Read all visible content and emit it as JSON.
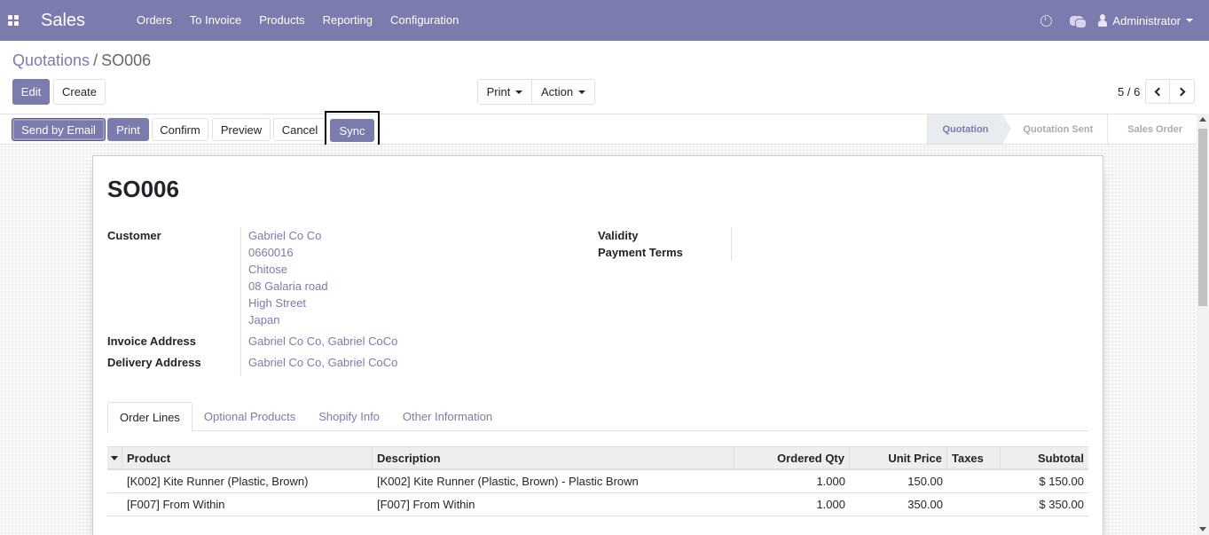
{
  "navbar": {
    "app_name": "Sales",
    "menu": [
      "Orders",
      "To Invoice",
      "Products",
      "Reporting",
      "Configuration"
    ],
    "user": "Administrator",
    "bg_color": "#7c7bad"
  },
  "breadcrumb": {
    "parent": "Quotations",
    "separator": "/",
    "current": "SO006"
  },
  "control": {
    "edit_label": "Edit",
    "create_label": "Create",
    "print_label": "Print",
    "action_label": "Action",
    "pager": "5 / 6"
  },
  "statusbar": {
    "send_email": "Send by Email",
    "print": "Print",
    "confirm": "Confirm",
    "preview": "Preview",
    "cancel": "Cancel",
    "sync": "Sync",
    "stages": [
      "Quotation",
      "Quotation Sent",
      "Sales Order"
    ],
    "active_stage": "Quotation"
  },
  "form": {
    "name": "SO006",
    "customer_label": "Customer",
    "customer_lines": [
      "Gabriel Co Co",
      "0660016",
      "Chitose",
      "08 Galaria road",
      "High Street",
      "Japan"
    ],
    "invoice_label": "Invoice Address",
    "invoice_value": "Gabriel Co Co, Gabriel CoCo",
    "delivery_label": "Delivery Address",
    "delivery_value": "Gabriel Co Co, Gabriel CoCo",
    "validity_label": "Validity",
    "payment_terms_label": "Payment Terms"
  },
  "tabs": [
    "Order Lines",
    "Optional Products",
    "Shopify Info",
    "Other Information"
  ],
  "order_lines": {
    "headers": [
      "Product",
      "Description",
      "Ordered Qty",
      "Unit Price",
      "Taxes",
      "Subtotal"
    ],
    "rows": [
      [
        "[K002] Kite Runner (Plastic, Brown)",
        "[K002] Kite Runner (Plastic, Brown) - Plastic  Brown",
        "1.000",
        "150.00",
        "",
        "$ 150.00"
      ],
      [
        "[F007] From Within",
        "[F007] From Within",
        "1.000",
        "350.00",
        "",
        "$ 350.00"
      ]
    ]
  }
}
